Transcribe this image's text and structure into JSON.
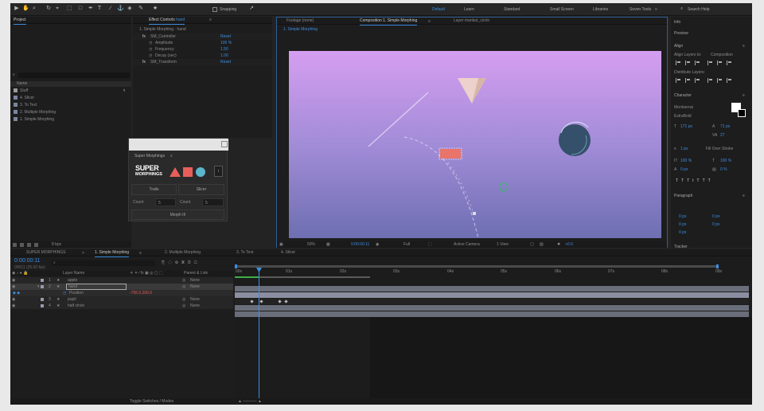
{
  "toolbar": {
    "snapping_label": "Snapping",
    "workspaces": [
      "Default",
      "Learn",
      "Standard",
      "Small Screen",
      "Libraries",
      "Seven Tools"
    ],
    "active_workspace": "Default",
    "search_placeholder": "Search Help"
  },
  "project": {
    "title": "Project",
    "column_name": "Name",
    "items": [
      "Stuff",
      "4. Slicer",
      "3. To Text",
      "2. Multiple Morphing",
      "1. Simple Morphing"
    ],
    "footer_label": "8 bpc"
  },
  "effect_controls": {
    "title_prefix": "Effect Controls",
    "title_layer": "hand",
    "breadcrumb": "1. Simple Morphing · hand",
    "effects": [
      {
        "name": "SM_Controller",
        "value": "Reset"
      },
      {
        "name": "Amplitude",
        "value": "100 %"
      },
      {
        "name": "Frequency",
        "value": "1.50"
      },
      {
        "name": "Decay (sec)",
        "value": "1.00"
      },
      {
        "name": "SM_Transform",
        "value": "Reset"
      }
    ]
  },
  "super_morphings": {
    "title": "Super Morphings",
    "logo_line1": "SUPER",
    "logo_line2": "MORPHINGS",
    "buttons": [
      "Trails",
      "Slicer"
    ],
    "count_label_1": "Count",
    "count_value_1": "5",
    "count_label_2": "Count",
    "count_value_2": "5",
    "morph_button": "Morph It!"
  },
  "viewer": {
    "tabs": [
      "Footage (none)",
      "Composition 1. Simple Morphing",
      "Layer manbut_circle"
    ],
    "comp_tab": "1. Simple Morphing",
    "zoom": "50%",
    "timecode": "0:00:00:11",
    "resolution": "Full",
    "camera": "Active Camera",
    "views": "1 View",
    "exposure": "+0.0"
  },
  "right_panels": {
    "info": "Info",
    "preview": "Preview",
    "align": "Align",
    "align_layers_to": "Align Layers to:",
    "align_target": "Composition",
    "distribute": "Distribute Layers:",
    "character": "Character",
    "font_family": "Montserrat",
    "font_style": "ExtraBold",
    "font_size": "171 px",
    "leading": "71 px",
    "tracking": "27",
    "stroke_width": "1 px",
    "stroke_type": "Fill Over Stroke",
    "vert_scale": "100 %",
    "horiz_scale": "100 %",
    "baseline": "0 px",
    "tsume": "0 %",
    "paragraph": "Paragraph",
    "para_values": [
      "0 px",
      "0 px",
      "0 px",
      "0 px",
      "0 px"
    ],
    "tracker": "Tracker"
  },
  "timeline": {
    "tabs": [
      "SUPER MORPHINGS",
      "1. Simple Morphing",
      "2. Multiple Morphing",
      "3. To Text",
      "4. Slicer"
    ],
    "active_tab": "1. Simple Morphing",
    "timecode": "0:00:00:11",
    "timecode_sub": "00011 (25.00 fps)",
    "columns": {
      "layer_name": "Layer Name",
      "parent": "Parent & Link"
    },
    "layers": [
      {
        "num": "1",
        "name": "apple",
        "parent": "None"
      },
      {
        "num": "2",
        "name": "hand",
        "parent": "None"
      },
      {
        "num": "",
        "name": "Position",
        "parent": "-765.0,200.0"
      },
      {
        "num": "3",
        "name": "pupil",
        "parent": "None"
      },
      {
        "num": "4",
        "name": "half circle",
        "parent": "None"
      }
    ],
    "ruler": [
      "00s",
      "01s",
      "02s",
      "03s",
      "04s",
      "05s",
      "06s",
      "07s",
      "08s",
      "09s"
    ],
    "footer": "Toggle Switches / Modes"
  },
  "colors": {
    "accent": "#3d8ee0",
    "comp_top": "#d59ef0",
    "comp_bottom": "#6e6fb2",
    "label_red": "#e8746a",
    "logo_square": "#e85f5a",
    "logo_circle": "#5bb6cc"
  }
}
